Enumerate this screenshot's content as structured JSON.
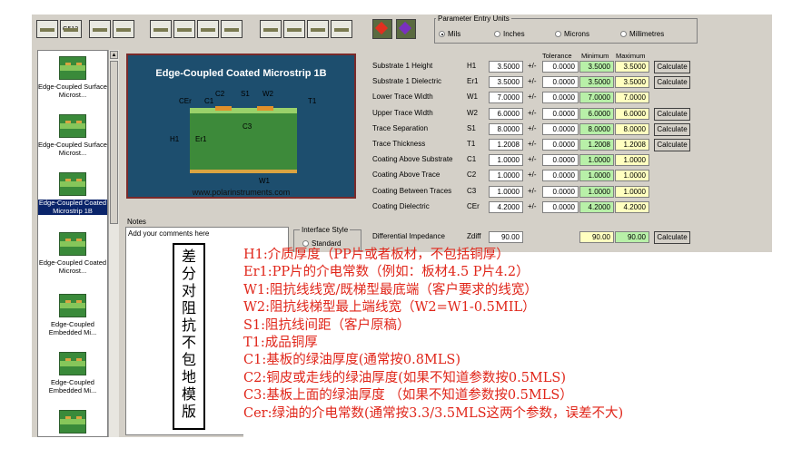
{
  "toolbar": {
    "groups": [
      {
        "count": 2,
        "labels": [
          "",
          "G512"
        ]
      },
      {
        "count": 2,
        "labels": [
          "",
          ""
        ]
      },
      {
        "count": 4,
        "labels": [
          "",
          "",
          "",
          ""
        ]
      },
      {
        "count": 4,
        "labels": [
          "",
          "",
          "",
          ""
        ]
      }
    ],
    "units_title": "Parameter Entry Units",
    "units": [
      {
        "label": "Mils",
        "selected": true
      },
      {
        "label": "Inches",
        "selected": false
      },
      {
        "label": "Microns",
        "selected": false
      },
      {
        "label": "Millimetres",
        "selected": false
      }
    ]
  },
  "sidebar": {
    "items": [
      {
        "label": "Edge-Coupled Surface Microst...",
        "selected": false
      },
      {
        "label": "Edge-Coupled Surface Microst...",
        "selected": false
      },
      {
        "label": "Edge-Coupled Coated Microstrip 1B",
        "selected": true
      },
      {
        "label": "Edge-Coupled Coated Microst...",
        "selected": false
      },
      {
        "label": "Edge-Coupled Embedded Mi...",
        "selected": false
      },
      {
        "label": "Edge-Coupled Embedded Mi...",
        "selected": false
      }
    ]
  },
  "diagram": {
    "title": "Edge-Coupled Coated Microstrip 1B",
    "url": "www.polarinstruments.com",
    "labels": {
      "cer": "CEr",
      "c1": "C1",
      "c2": "C2",
      "s1": "S1",
      "w2": "W2",
      "t1": "T1",
      "c3": "C3",
      "h1": "H1",
      "er1": "Er1",
      "w1": "W1"
    }
  },
  "notes": {
    "label": "Notes",
    "placeholder": "Add your comments here"
  },
  "interface": {
    "title": "Interface Style",
    "option": "Standard"
  },
  "params": {
    "headers": {
      "tolerance": "Tolerance",
      "minimum": "Minimum",
      "maximum": "Maximum"
    },
    "pm": "+/-",
    "calculate": "Calculate",
    "rows": [
      {
        "label": "Substrate 1 Height",
        "sym": "H1",
        "value": "3.5000",
        "tol": "0.0000",
        "min": "3.5000",
        "max": "3.5000",
        "calc": true
      },
      {
        "label": "Substrate 1 Dielectric",
        "sym": "Er1",
        "value": "3.5000",
        "tol": "0.0000",
        "min": "3.5000",
        "max": "3.5000",
        "calc": true
      },
      {
        "label": "Lower Trace Width",
        "sym": "W1",
        "value": "7.0000",
        "tol": "0.0000",
        "min": "7.0000",
        "max": "7.0000",
        "calc": false
      },
      {
        "label": "Upper Trace Width",
        "sym": "W2",
        "value": "6.0000",
        "tol": "0.0000",
        "min": "6.0000",
        "max": "6.0000",
        "calc": true
      },
      {
        "label": "Trace Separation",
        "sym": "S1",
        "value": "8.0000",
        "tol": "0.0000",
        "min": "8.0000",
        "max": "8.0000",
        "calc": true
      },
      {
        "label": "Trace Thickness",
        "sym": "T1",
        "value": "1.2008",
        "tol": "0.0000",
        "min": "1.2008",
        "max": "1.2008",
        "calc": true
      },
      {
        "label": "Coating Above Substrate",
        "sym": "C1",
        "value": "1.0000",
        "tol": "0.0000",
        "min": "1.0000",
        "max": "1.0000",
        "calc": false
      },
      {
        "label": "Coating Above Trace",
        "sym": "C2",
        "value": "1.0000",
        "tol": "0.0000",
        "min": "1.0000",
        "max": "1.0000",
        "calc": false
      },
      {
        "label": "Coating Between Traces",
        "sym": "C3",
        "value": "1.0000",
        "tol": "0.0000",
        "min": "1.0000",
        "max": "1.0000",
        "calc": false
      },
      {
        "label": "Coating Dielectric",
        "sym": "CEr",
        "value": "4.2000",
        "tol": "0.0000",
        "min": "4.2000",
        "max": "4.2000",
        "calc": false
      }
    ],
    "impedance": {
      "label": "Differential Impedance",
      "sym": "Zdiff",
      "value": "90.00",
      "min": "90.00",
      "max": "90.00",
      "calc": "Calculate"
    }
  },
  "annotations": {
    "vertical_title": [
      "差",
      "分",
      "对",
      "阻",
      "抗",
      "不",
      "包",
      "地",
      "模",
      "版"
    ],
    "lines": [
      "H1:介质厚度（PP片或者板材，不包括铜厚）",
      "Er1:PP片的介电常数（例如：板材4.5  P片4.2）",
      "W1:阻抗线线宽/既梯型最底端（客户要求的线宽）",
      "W2:阻抗线梯型最上端线宽（W2=W1-0.5MIL）",
      "S1:阻抗线间距（客户原稿）",
      "T1:成品铜厚",
      "C1:基板的绿油厚度(通常按0.8MLS)",
      "C2:铜皮或走线的绿油厚度(如果不知道参数按0.5MLS)",
      "C3:基板上面的绿油厚度  （如果不知道参数按0.5MLS）",
      "Cer:绿油的介电常数(通常按3.3/3.5MLS这两个参数，误差不大)"
    ]
  }
}
